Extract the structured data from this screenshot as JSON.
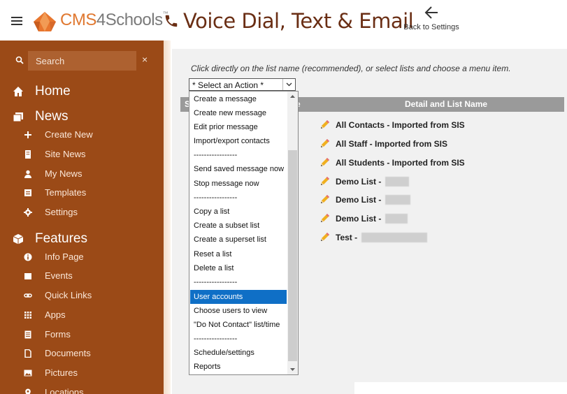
{
  "header": {
    "brand": {
      "part1": "CMS",
      "part2": "4Schools",
      "tm": "™"
    },
    "title": "Voice Dial, Text & Email",
    "back_label": "Back to Settings"
  },
  "sidebar": {
    "search_placeholder": "Search",
    "close_glyph": "×",
    "sections": [
      {
        "label": "Home",
        "icon": "home-icon"
      },
      {
        "label": "News",
        "icon": "news-icon",
        "items": [
          {
            "label": "Create New",
            "icon": "plus-icon"
          },
          {
            "label": "Site News",
            "icon": "building-icon"
          },
          {
            "label": "My News",
            "icon": "user-icon"
          },
          {
            "label": "Templates",
            "icon": "template-icon"
          },
          {
            "label": "Settings",
            "icon": "gear-icon"
          }
        ]
      },
      {
        "label": "Features",
        "icon": "cube-icon",
        "items": [
          {
            "label": "Info Page",
            "icon": "info-icon"
          },
          {
            "label": "Events",
            "icon": "calendar-icon"
          },
          {
            "label": "Quick Links",
            "icon": "link-icon"
          },
          {
            "label": "Apps",
            "icon": "grid-icon"
          },
          {
            "label": "Forms",
            "icon": "form-icon"
          },
          {
            "label": "Documents",
            "icon": "document-icon"
          },
          {
            "label": "Pictures",
            "icon": "picture-icon"
          },
          {
            "label": "Locations",
            "icon": "location-icon"
          }
        ]
      }
    ]
  },
  "main": {
    "instruction": "Click directly on the list name (recommended), or select lists and choose a menu item.",
    "action_select": {
      "value": "* Select an Action *",
      "options": [
        "Create a message",
        "Create new message",
        "Edit prior message",
        "Import/export contacts",
        "-----------------",
        "Send saved message now",
        "Stop message now",
        "-----------------",
        "Copy a list",
        "Create a subset list",
        "Create a superset list",
        "Reset a list",
        "Delete a list",
        "-----------------",
        "User accounts",
        "Choose users to view",
        "\"Do Not Contact\" list/time",
        "-----------------",
        "Schedule/settings",
        "Reports"
      ],
      "highlighted": "User accounts"
    },
    "table": {
      "headers": {
        "col1": "S",
        "col2": "e",
        "detail": "Detail and List Name"
      },
      "rows": [
        {
          "name": "All Contacts - Imported from SIS"
        },
        {
          "name": "All Staff - Imported from SIS"
        },
        {
          "name": "All Students - Imported from SIS"
        },
        {
          "name": "Demo List -"
        },
        {
          "name": "Demo List -"
        },
        {
          "name": "Demo List -"
        },
        {
          "name": "Test -"
        }
      ]
    }
  }
}
